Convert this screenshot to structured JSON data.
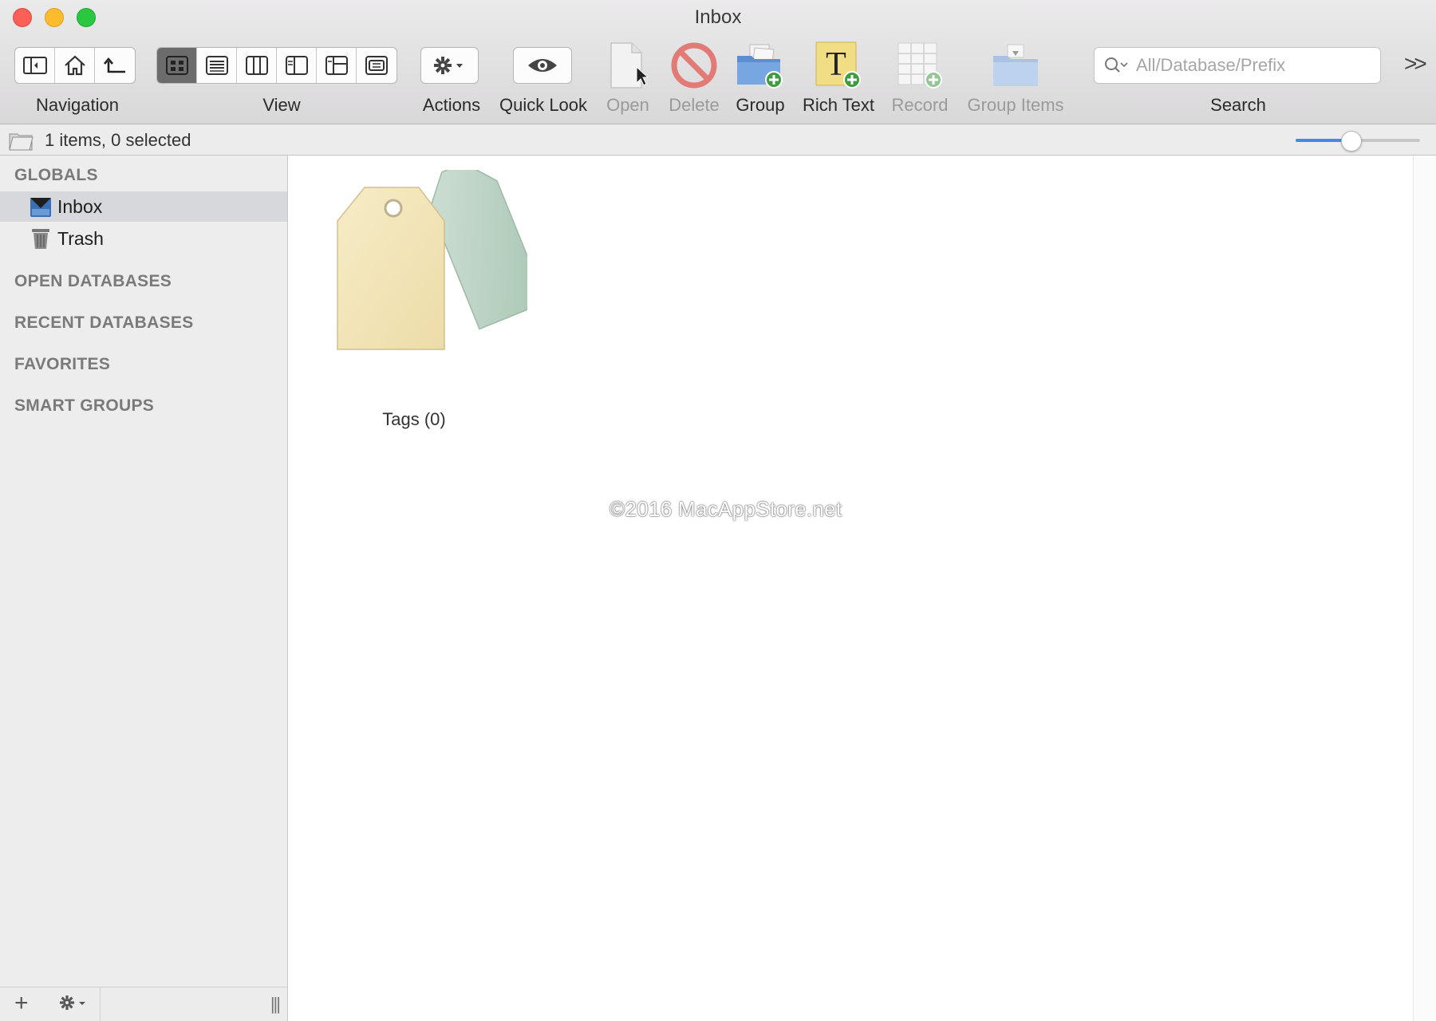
{
  "window": {
    "title": "Inbox"
  },
  "toolbar": {
    "navigation_label": "Navigation",
    "view_label": "View",
    "actions_label": "Actions",
    "quick_look_label": "Quick Look",
    "open_label": "Open",
    "delete_label": "Delete",
    "group_label": "Group",
    "rich_text_label": "Rich Text",
    "record_label": "Record",
    "group_items_label": "Group Items",
    "search_label": "Search",
    "search_placeholder": "All/Database/Prefix"
  },
  "status": {
    "text": "1 items, 0 selected",
    "zoom_fraction": 0.44
  },
  "sidebar": {
    "globals_title": "GLOBALS",
    "globals": [
      {
        "label": "Inbox",
        "icon": "inbox-icon",
        "selected": true
      },
      {
        "label": "Trash",
        "icon": "trash-icon",
        "selected": false
      }
    ],
    "open_databases_title": "OPEN DATABASES",
    "recent_databases_title": "RECENT DATABASES",
    "favorites_title": "FAVORITES",
    "smart_groups_title": "SMART GROUPS"
  },
  "content": {
    "items": [
      {
        "label": "Tags (0)",
        "icon": "tags-icon"
      }
    ],
    "watermark": "©2016 MacAppStore.net"
  },
  "colors": {
    "accent": "#3d8bf1",
    "selection": "#d7d8dc",
    "tag_front": "#f3e6bd",
    "tag_back": "#b9d2c3"
  }
}
